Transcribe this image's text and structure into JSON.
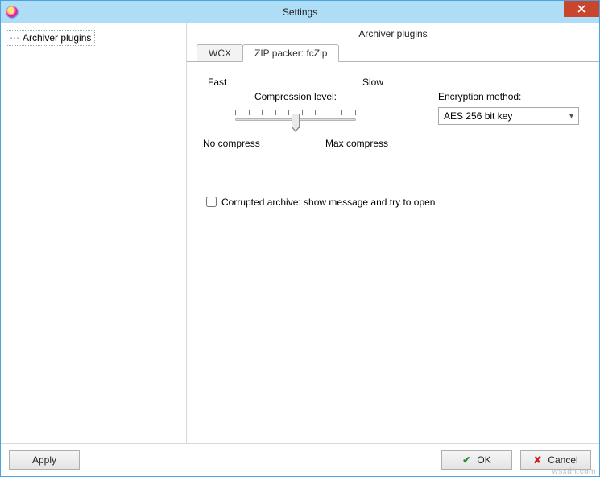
{
  "window": {
    "title": "Settings",
    "close_icon": "close"
  },
  "sidebar": {
    "items": [
      {
        "label": "Archiver plugins"
      }
    ]
  },
  "panel": {
    "title": "Archiver plugins"
  },
  "tabs": [
    {
      "label": "WCX",
      "active": false
    },
    {
      "label": "ZIP packer: fcZip",
      "active": true
    }
  ],
  "compression": {
    "fast": "Fast",
    "slow": "Slow",
    "level_label": "Compression level:",
    "no_compress": "No compress",
    "max_compress": "Max compress",
    "ticks": 10,
    "value": 5
  },
  "encryption": {
    "label": "Encryption method:",
    "selected": "AES 256 bit key"
  },
  "corrupted": {
    "checked": false,
    "label": "Corrupted archive: show message and try to open"
  },
  "buttons": {
    "apply": "Apply",
    "ok": "OK",
    "cancel": "Cancel"
  },
  "watermark": "wsxdn.com"
}
